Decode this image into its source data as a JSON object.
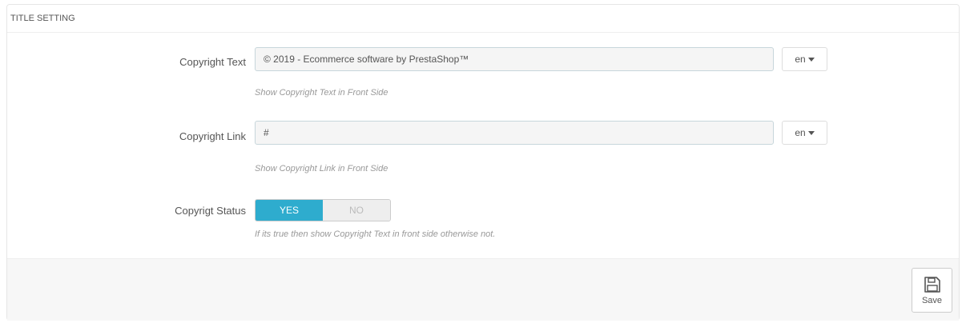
{
  "panel": {
    "title": "TITLE SETTING"
  },
  "fields": {
    "copyright_text": {
      "label": "Copyright Text",
      "value": "© 2019 - Ecommerce software by PrestaShop™",
      "help": "Show Copyright Text in Front Side",
      "lang": "en"
    },
    "copyright_link": {
      "label": "Copyright Link",
      "value": "#",
      "help": "Show Copyright Link in Front Side",
      "lang": "en"
    },
    "copyright_status": {
      "label": "Copyrigt Status",
      "yes_label": "YES",
      "no_label": "NO",
      "selected": "YES",
      "help": "If its true then show Copyright Text in front side otherwise not."
    }
  },
  "footer": {
    "save_label": "Save",
    "save_icon": "floppy-disk-icon"
  },
  "colors": {
    "accent": "#2eacce",
    "input_bg": "#f5f5f5",
    "footer_bg": "#f7f7f7"
  }
}
